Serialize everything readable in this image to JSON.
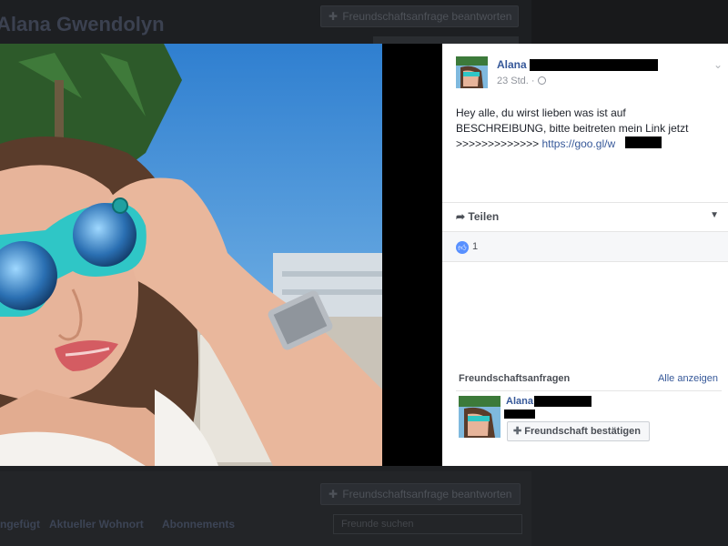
{
  "background": {
    "profile_name": "Alana Gwendolyn",
    "friend_request_button": "Freundschaftsanfrage beantworten",
    "nav_items": [
      "ngefügt",
      "Aktueller Wohnort",
      "Abonnements"
    ],
    "search_placeholder": "Freunde suchen"
  },
  "post": {
    "author": "Alana",
    "time": "23 Std.",
    "time_separator": "·",
    "text_line1": "Hey alle, du wirst lieben was ist auf",
    "text_line2": "BESCHREIBUNG, bitte beitreten mein Link jetzt",
    "text_line3_prefix": ">>>>>>>>>>>>> ",
    "link": "https://goo.gl/w",
    "share_label": "Teilen",
    "like_count": "1"
  },
  "friend_requests": {
    "header": "Freundschaftsanfragen",
    "see_all": "Alle anzeigen",
    "name": "Alana",
    "confirm_button": "Freundschaft bestätigen"
  },
  "colors": {
    "link": "#365899",
    "like_blue": "#5890ff",
    "overlay_bg": "#1d1f22"
  }
}
